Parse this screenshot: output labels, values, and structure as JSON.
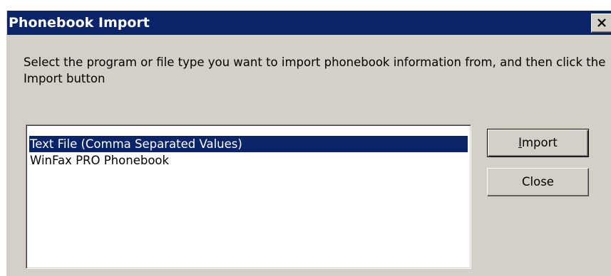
{
  "window": {
    "title": "Phonebook Import",
    "close_icon": "close-icon"
  },
  "instructions": "Select the program or file type you want to import phonebook information from, and then click the Import button",
  "source_list": {
    "items": [
      {
        "label": "Text File (Comma Separated Values)",
        "selected": true
      },
      {
        "label": "WinFax PRO Phonebook",
        "selected": false
      }
    ]
  },
  "buttons": {
    "import_mnemonic": "I",
    "import_rest": "mport",
    "close_label": "Close"
  },
  "colors": {
    "titlebar": "#0a246a",
    "face": "#d4d0c8",
    "selection": "#0a246a"
  }
}
